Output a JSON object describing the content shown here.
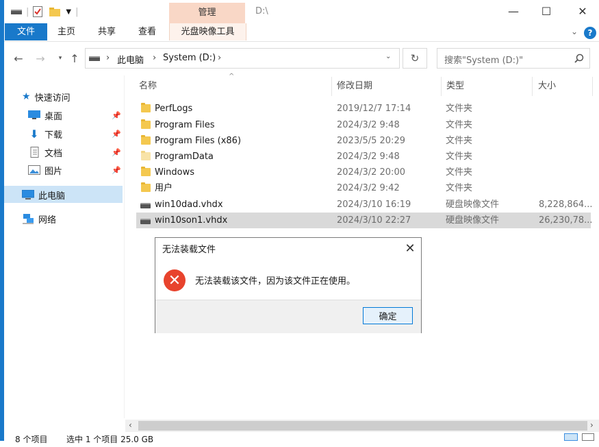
{
  "window": {
    "context_tab": "管理",
    "path_title": "D:\\",
    "controls": {
      "minimize": "—",
      "maximize": "☐",
      "close": "✕"
    }
  },
  "ribbon": {
    "tabs": [
      "文件",
      "主页",
      "共享",
      "查看"
    ],
    "context_tab": "光盘映像工具"
  },
  "address": {
    "crumbs": [
      "此电脑",
      "System (D:)"
    ],
    "search_placeholder": "搜索\"System (D:)\""
  },
  "nav": {
    "quick_access": "快速访问",
    "pinned": [
      "桌面",
      "下载",
      "文档",
      "图片"
    ],
    "this_pc": "此电脑",
    "network": "网络"
  },
  "columns": {
    "name": "名称",
    "date": "修改日期",
    "type": "类型",
    "size": "大小"
  },
  "files": [
    {
      "name": "PerfLogs",
      "date": "2019/12/7 17:14",
      "type": "文件夹",
      "size": "",
      "icon": "folder-icon"
    },
    {
      "name": "Program Files",
      "date": "2024/3/2 9:48",
      "type": "文件夹",
      "size": "",
      "icon": "folder-icon"
    },
    {
      "name": "Program Files (x86)",
      "date": "2023/5/5 20:29",
      "type": "文件夹",
      "size": "",
      "icon": "folder-icon"
    },
    {
      "name": "ProgramData",
      "date": "2024/3/2 9:48",
      "type": "文件夹",
      "size": "",
      "icon": "folder-icon"
    },
    {
      "name": "Windows",
      "date": "2024/3/2 20:00",
      "type": "文件夹",
      "size": "",
      "icon": "folder-icon"
    },
    {
      "name": "用户",
      "date": "2024/3/2 9:42",
      "type": "文件夹",
      "size": "",
      "icon": "folder-icon"
    },
    {
      "name": "win10dad.vhdx",
      "date": "2024/3/10 16:19",
      "type": "硬盘映像文件",
      "size": "8,228,864...",
      "icon": "disk-image-icon"
    },
    {
      "name": "win10son1.vhdx",
      "date": "2024/3/10 22:27",
      "type": "硬盘映像文件",
      "size": "26,230,78...",
      "icon": "disk-image-icon",
      "selected": true
    }
  ],
  "dialog": {
    "title": "无法装载文件",
    "message": "无法装载该文件，因为该文件正在使用。",
    "ok": "确定"
  },
  "status": {
    "count": "8 个项目",
    "selection": "选中 1 个项目  25.0 GB"
  }
}
